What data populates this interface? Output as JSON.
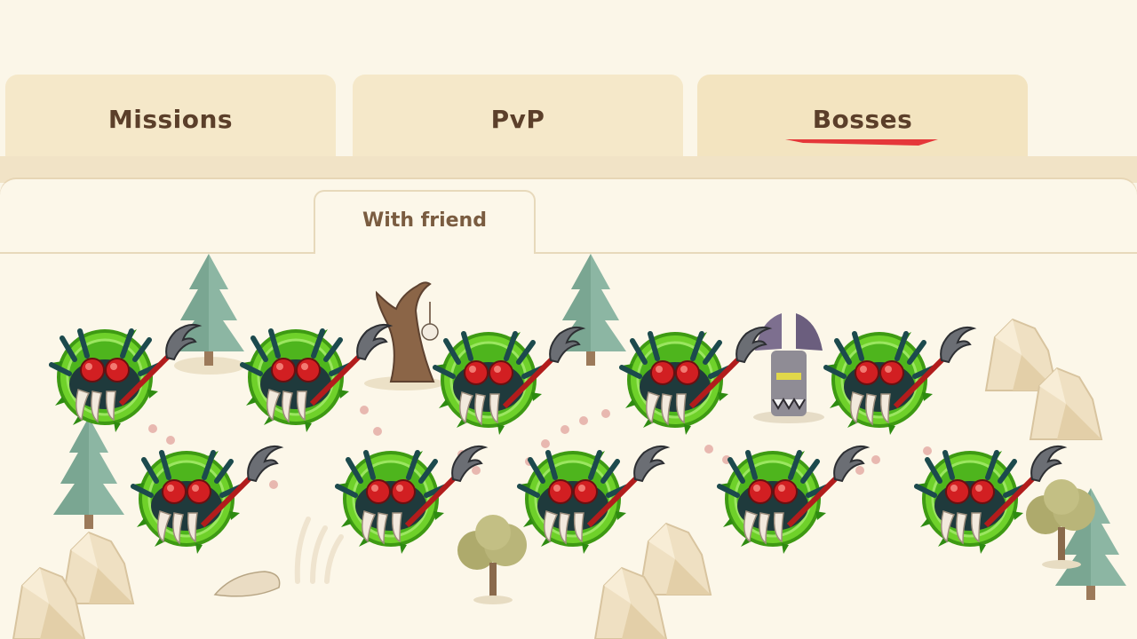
{
  "tabs": [
    {
      "label": "Missions",
      "active": false
    },
    {
      "label": "PvP",
      "active": false
    },
    {
      "label": "Bosses",
      "active": true
    }
  ],
  "subtabs": [
    {
      "label": "With friend",
      "active": true
    }
  ],
  "colors": {
    "tab_bg": "#f5e8c9",
    "panel_bg": "#fcf7e9",
    "tab_text": "#5b3f2a",
    "active_underline": "#e5373a",
    "node_ring": "#6fd12a",
    "dot_path": "#e8b8b0"
  },
  "map": {
    "boss_nodes_row1": [
      {
        "icon": "spider-boss-icon"
      },
      {
        "icon": "spider-boss-icon"
      },
      {
        "icon": "spider-boss-icon"
      },
      {
        "icon": "spider-boss-icon"
      },
      {
        "icon": "spider-boss-icon"
      }
    ],
    "boss_nodes_row2": [
      {
        "icon": "spider-boss-icon"
      },
      {
        "icon": "spider-boss-icon"
      },
      {
        "icon": "spider-boss-icon"
      },
      {
        "icon": "spider-boss-icon"
      },
      {
        "icon": "spider-boss-icon"
      }
    ],
    "decor": [
      "pine-tree-icon",
      "dead-tree-icon",
      "totem-statue-icon",
      "rock-icon",
      "bush-tree-icon",
      "skull-icon",
      "bones-icon"
    ]
  }
}
